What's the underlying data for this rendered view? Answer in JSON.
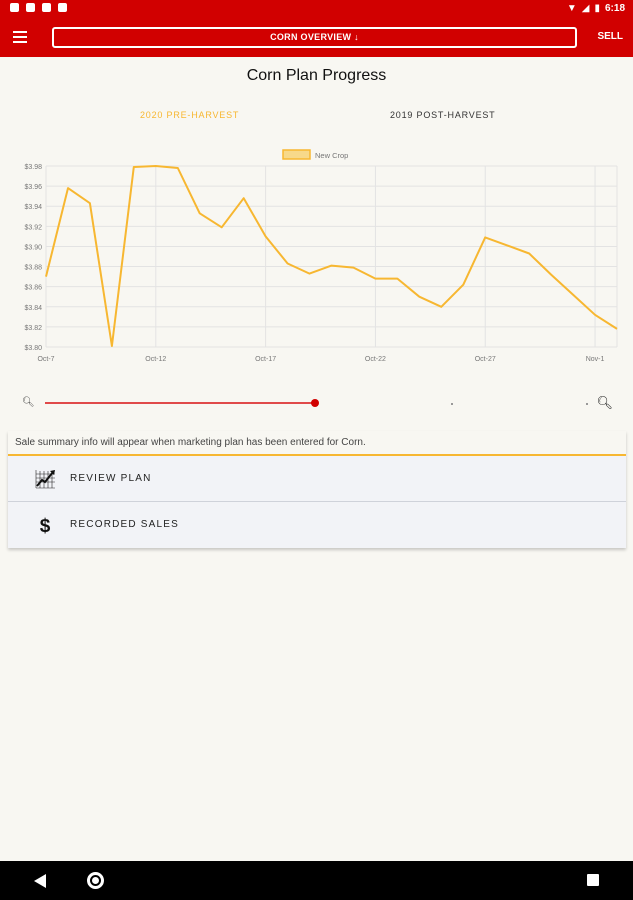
{
  "status": {
    "time": "6:18"
  },
  "toolbar": {
    "overview_label": "CORN OVERVIEW ↓",
    "sell_label": "SELL"
  },
  "page": {
    "title": "Corn Plan Progress"
  },
  "tabs": [
    {
      "label": "2020 PRE-HARVEST"
    },
    {
      "label": "2019 POST-HARVEST"
    }
  ],
  "chart_data": {
    "type": "line",
    "series": [
      {
        "name": "New Crop",
        "color": "#f7b731",
        "values": [
          3.87,
          3.958,
          3.943,
          3.801,
          3.979,
          3.98,
          3.978,
          3.933,
          3.919,
          3.948,
          3.91,
          3.883,
          3.873,
          3.881,
          3.879,
          3.868,
          3.868,
          3.85,
          3.84,
          3.862,
          3.909,
          3.901,
          3.893,
          3.872,
          3.852,
          3.832,
          3.818
        ]
      }
    ],
    "x_ticks": [
      "Oct-7",
      "Oct-12",
      "Oct-17",
      "Oct-22",
      "Oct-27",
      "Nov-1"
    ],
    "y_ticks": [
      "$3.80",
      "$3.82",
      "$3.84",
      "$3.86",
      "$3.88",
      "$3.90",
      "$3.92",
      "$3.94",
      "$3.96",
      "$3.98"
    ],
    "ylim": [
      3.8,
      3.98
    ],
    "grid": true,
    "legend": "top-center"
  },
  "summary": {
    "text": "Sale summary info will appear when marketing plan has been entered for Corn."
  },
  "actions": [
    {
      "label": "REVIEW PLAN",
      "icon": "chart-trend-icon"
    },
    {
      "label": "RECORDED SALES",
      "icon": "dollar-icon"
    }
  ]
}
